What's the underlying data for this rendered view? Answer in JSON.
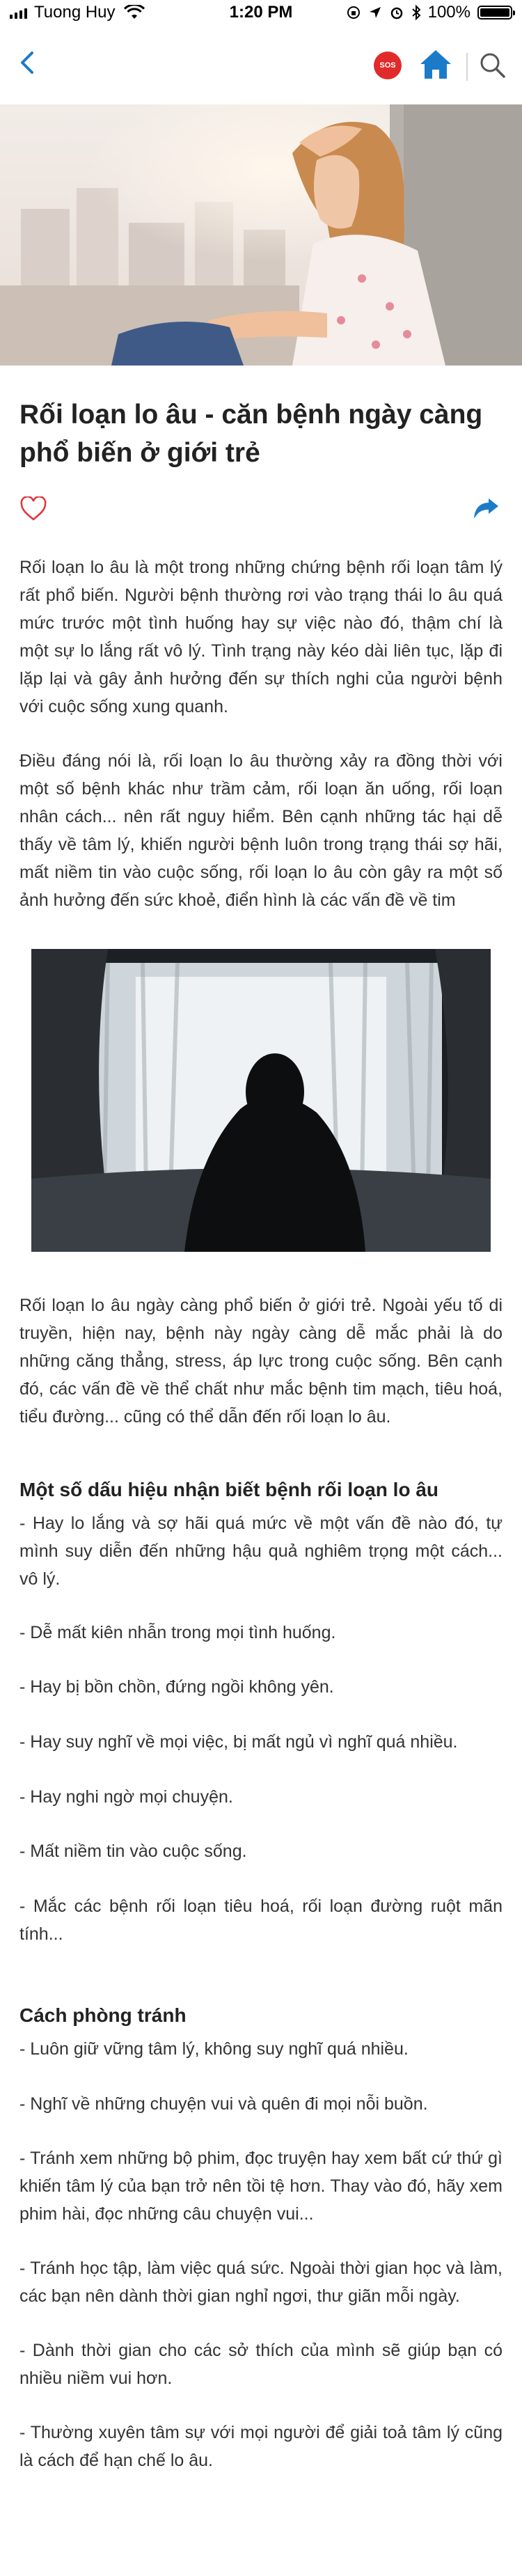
{
  "status_bar": {
    "carrier": "Tuong Huy",
    "time": "1:20 PM",
    "battery": "100%"
  },
  "nav": {
    "sos_label": "SOS",
    "icons": [
      "back-chevron-icon",
      "sos-icon",
      "home-icon",
      "search-icon"
    ],
    "accent_color": "#1c7bc8"
  },
  "article": {
    "title": "Rối loạn lo âu - căn bệnh ngày càng phổ biến ở giới trẻ",
    "intro_paragraphs": [
      "Rối loạn lo âu là một trong những chứng bệnh rối loạn tâm lý rất phổ biến. Người bệnh thường rơi vào trạng thái lo âu quá mức trước một tình huống hay sự việc nào đó, thậm chí là một sự lo lắng rất vô lý. Tình trạng này kéo dài liên tục, lặp đi lặp lại và gây ảnh hưởng đến sự thích nghi của người bệnh với cuộc sống xung quanh.",
      "Điều đáng nói là, rối loạn lo âu thường xảy ra đồng thời với một số bệnh khác như trầm cảm, rối loạn ăn uống, rối loạn nhân cách... nên rất nguy hiểm. Bên cạnh những tác hại dễ thấy về tâm lý, khiến người bệnh luôn trong trạng thái sợ hãi, mất niềm tin vào cuộc sống, rối loạn lo âu còn gây ra một số ảnh hưởng đến sức khoẻ, điển hình là các vấn đề về tim",
      "Rối loạn lo âu ngày càng phổ biến ở giới trẻ. Ngoài yếu tố di truyền, hiện nay, bệnh này ngày càng dễ mắc phải là do những căng thẳng, stress, áp lực trong cuộc sống. Bên cạnh đó, các vấn đề về thể chất như mắc bệnh tim mạch, tiêu hoá, tiểu đường... cũng có thể dẫn đến rối loạn lo âu."
    ],
    "signs_heading": "Một số dấu hiệu nhận biết bệnh rối loạn lo âu",
    "signs": [
      "- Hay lo lắng và sợ hãi quá mức về một vấn đề nào đó, tự mình suy diễn đến những hậu quả nghiêm trọng một cách... vô lý.",
      "- Dễ mất kiên nhẫn trong mọi tình huống.",
      "- Hay bị bồn chồn, đứng ngồi không yên.",
      "- Hay suy nghĩ về mọi việc, bị mất ngủ vì nghĩ quá nhiều.",
      "- Hay nghi ngờ mọi chuyện.",
      "- Mất niềm tin vào cuộc sống.",
      "- Mắc các bệnh rối loạn tiêu hoá, rối loạn đường ruột mãn tính..."
    ],
    "prevention_heading": "Cách phòng tránh",
    "prevention": [
      "- Luôn giữ vững tâm lý, không suy nghĩ quá nhiều.",
      "- Nghĩ về những chuyện vui và quên đi mọi nỗi buồn.",
      "- Tránh xem những bộ phim, đọc truyện hay xem bất cứ thứ gì khiến tâm lý của bạn trở nên tồi tệ hơn. Thay vào đó, hãy xem phim hài, đọc những câu chuyện vui...",
      "- Tránh học tập, làm việc quá sức. Ngoài thời gian học và làm, các bạn nên dành thời gian nghỉ ngơi, thư giãn mỗi ngày.",
      "- Dành thời gian cho các sở thích của mình sẽ giúp bạn có nhiều niềm vui hơn.",
      "- Thường xuyên tâm sự với mọi người để giải toả tâm lý cũng là cách để hạn chế lo âu."
    ]
  }
}
